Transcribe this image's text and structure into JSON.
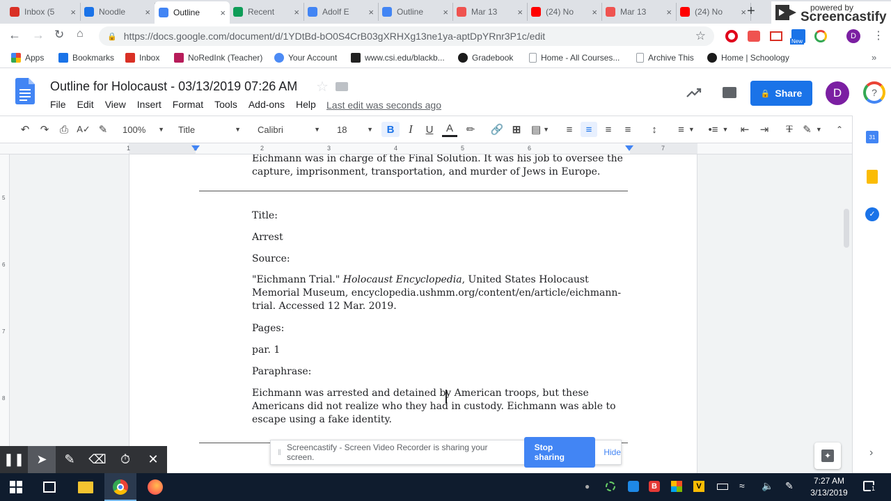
{
  "tabs": [
    {
      "label": "Inbox (5",
      "icon": "gmail-icon",
      "color": "#d93025"
    },
    {
      "label": "Noodle",
      "icon": "noodletools-icon",
      "color": "#1a73e8"
    },
    {
      "label": "Outline",
      "icon": "docs-icon",
      "color": "#4285f4",
      "active": true
    },
    {
      "label": "Recent",
      "icon": "drive-icon",
      "color": "#0f9d58"
    },
    {
      "label": "Adolf E",
      "icon": "docs-icon",
      "color": "#4285f4"
    },
    {
      "label": "Outline",
      "icon": "docs-icon",
      "color": "#4285f4"
    },
    {
      "label": "Mar 13",
      "icon": "screencastify-icon",
      "color": "#ef5350"
    },
    {
      "label": "(24) No",
      "icon": "youtube-icon",
      "color": "#ff0000"
    },
    {
      "label": "Mar 13",
      "icon": "screencastify-icon",
      "color": "#ef5350"
    },
    {
      "label": "(24) No",
      "icon": "youtube-icon",
      "color": "#ff0000"
    }
  ],
  "watermark": {
    "powered": "powered by",
    "brand": "Screencastify"
  },
  "url": "https://docs.google.com/document/d/1YDtBd-bO0S4CrB03gXRHXg13ne1ya-aptDpYRnr3P1c/edit",
  "ext_new_label": "New",
  "profile_initial": "D",
  "bookmarks": [
    {
      "label": "Apps",
      "icon": "apps-grid-icon",
      "color": "#ea4335"
    },
    {
      "label": "Bookmarks",
      "icon": "star-icon",
      "color": "#1a73e8"
    },
    {
      "label": "Inbox",
      "icon": "gmail-icon",
      "color": "#d93025"
    },
    {
      "label": "NoRedInk (Teacher)",
      "icon": "noredink-icon",
      "color": "#b71c5a"
    },
    {
      "label": "Your Account",
      "icon": "account-icon",
      "color": "#4c8bf5"
    },
    {
      "label": "www.csi.edu/blackb...",
      "icon": "csi-icon",
      "color": "#222222"
    },
    {
      "label": "Gradebook",
      "icon": "schoology-icon",
      "color": "#1b1b1b"
    },
    {
      "label": "Home - All Courses...",
      "icon": "page-icon",
      "color": "#9aa0a6"
    },
    {
      "label": "Archive This",
      "icon": "page-icon",
      "color": "#9aa0a6"
    },
    {
      "label": "Home | Schoology",
      "icon": "schoology-icon",
      "color": "#1b1b1b"
    }
  ],
  "doc": {
    "title": "Outline for Holocaust - 03/13/2019 07:26 AM",
    "menus": [
      "File",
      "Edit",
      "View",
      "Insert",
      "Format",
      "Tools",
      "Add-ons",
      "Help"
    ],
    "last_edit": "Last edit was seconds ago",
    "share_label": "Share",
    "avatar": "D"
  },
  "toolbar": {
    "zoom": "100%",
    "style": "Title",
    "font": "Calibri",
    "size": "18"
  },
  "ruler": [
    "1",
    "1",
    "2",
    "3",
    "4",
    "5",
    "6",
    "7"
  ],
  "left_ruler": [
    "5",
    "6",
    "7",
    "8"
  ],
  "content": {
    "top_text": "Eichmann was in charge of the Final Solution. It was his job to oversee the capture, imprisonment, transportation, and murder of Jews in Europe.",
    "title_label": "Title:",
    "title_value": "Arrest",
    "source_label": "Source:",
    "source_quote": "\"Eichmann Trial.\"",
    "source_italic": "Holocaust Encyclopedia",
    "source_rest": ", United States Holocaust Memorial Museum, encyclopedia.ushmm.org/content/en/article/eichmann-trial. Accessed 12 Mar. 2019.",
    "pages_label": "Pages:",
    "pages_value": "par. 1",
    "paraphrase_label": "Paraphrase:",
    "paraphrase_value": "Eichmann was arrested and detained by American troops, but these Americans did not realize who they had in custody. Eichmann was able to escape using a fake identity."
  },
  "sharebar": {
    "message": "Screencastify - Screen Video Recorder is sharing your screen.",
    "stop": "Stop sharing",
    "hide": "Hide"
  },
  "taskbar": {
    "time": "7:27 AM",
    "date": "3/13/2019",
    "notif_count": "1"
  },
  "colors": {
    "accent": "#1a73e8",
    "taskbar": "#0f1c2e"
  }
}
